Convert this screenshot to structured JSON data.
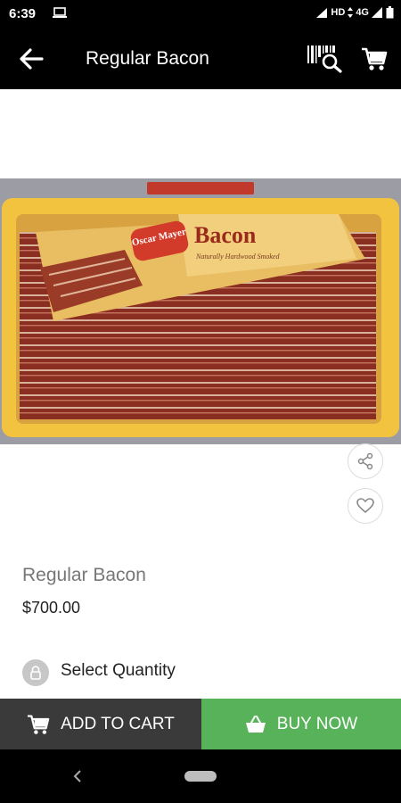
{
  "status_bar": {
    "time": "6:39",
    "network": "HD",
    "network_type": "4G"
  },
  "app_bar": {
    "title": "Regular Bacon"
  },
  "product": {
    "image": {
      "brand_logo": "Oscar Mayer",
      "label_title": "Bacon",
      "label_subtitle": "Naturally Hardwood Smoked",
      "colors": {
        "package": "#e7b85a",
        "tray": "#f2c33f",
        "bacon": "#8a2e22"
      }
    },
    "name": "Regular Bacon",
    "price": "$700.00"
  },
  "quantity": {
    "label": "Select Quantity"
  },
  "actions": {
    "add_to_cart_label": "ADD TO CART",
    "buy_now_label": "BUY NOW",
    "buy_now_color": "#58b25a",
    "add_to_cart_color": "#3a3a3a"
  },
  "icons": [
    "back-arrow-icon",
    "barcode-search-icon",
    "cart-icon",
    "share-icon",
    "heart-icon",
    "lock-icon",
    "basket-icon"
  ]
}
